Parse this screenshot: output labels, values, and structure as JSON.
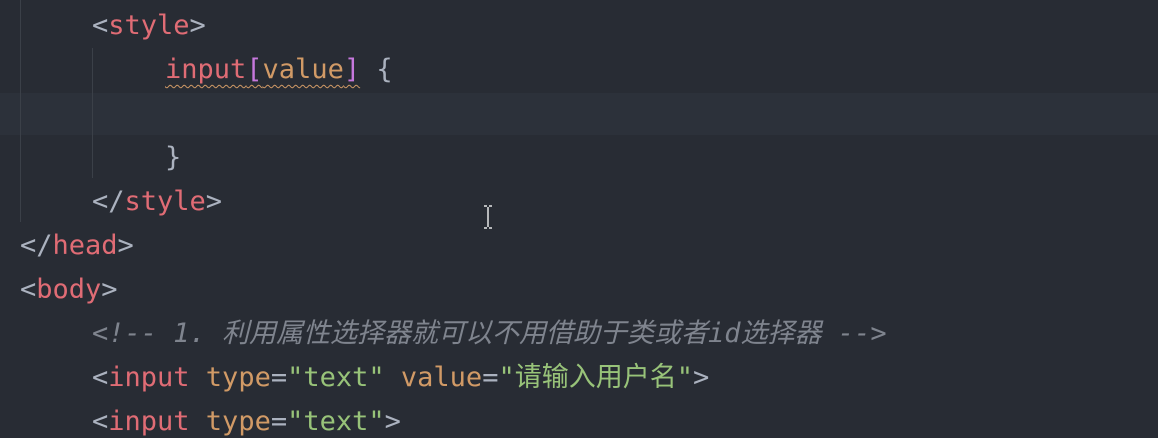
{
  "editor": {
    "lines": {
      "style_open": {
        "open": "<",
        "name": "style",
        "close": ">"
      },
      "selector": {
        "tag": "input",
        "lbracket": "[",
        "attr": "value",
        "rbracket": "]",
        "brace": " {"
      },
      "close_brace": "}",
      "style_close": {
        "open": "</",
        "name": "style",
        "close": ">"
      },
      "head_close": {
        "open": "</",
        "name": "head",
        "close": ">"
      },
      "body_open": {
        "open": "<",
        "name": "body",
        "close": ">"
      },
      "comment": "<!-- 1. 利用属性选择器就可以不用借助于类或者id选择器 -->",
      "input1": {
        "open": "<",
        "name": "input",
        "attr1": " type",
        "eq1": "=",
        "val1": "\"text\"",
        "attr2": " value",
        "eq2": "=",
        "val2": "\"请输入用户名\"",
        "close": ">"
      },
      "input2": {
        "open": "<",
        "name": "input",
        "attr1": " type",
        "eq1": "=",
        "val1": "\"text\"",
        "close": ">"
      }
    }
  },
  "colors": {
    "background": "#282c34",
    "tag": "#e06c75",
    "attribute": "#d19a66",
    "string": "#98c379",
    "comment": "#7f848e",
    "bracket": "#c678dd"
  },
  "icons": {
    "cursor": "text-cursor-icon"
  }
}
